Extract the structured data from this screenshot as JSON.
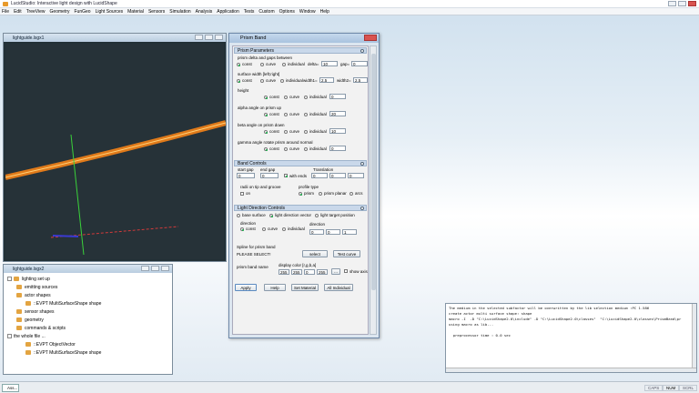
{
  "app": {
    "title": "LucidStudio: Interactive light design with LucidShape"
  },
  "menu": [
    "File",
    "Edit",
    "TreeView",
    "Geometry",
    "FunGeo",
    "Light Sources",
    "Material",
    "Sensors",
    "Simulation",
    "Analysis",
    "Application",
    "Tests",
    "Custom",
    "Options",
    "Window",
    "Help"
  ],
  "viewer": {
    "title": "lightguide.lsgx1"
  },
  "tree": {
    "title": "lightguide.lsgx2",
    "items": [
      "lighting set up",
      "emitting sources",
      "actor shapes",
      "::EVPT MultiSurfaceShape   shape",
      "sensor shapes",
      "geometry",
      "commands & scripts",
      "the whole file ...",
      "::EVPT ObjectVector",
      "::EVPT MultiSurfaceShape   shape"
    ]
  },
  "dialog": {
    "title": "Prism Band",
    "s1": "Prism Parameters",
    "gap_label": "prism delta and gaps between",
    "r_const": "const",
    "r_curve": "curve",
    "r_individual": "individual",
    "delta_label": "delta=",
    "delta_val": "10",
    "gap_label2": "gap=",
    "gap_val": "0",
    "width_label": "surface width [left;right]",
    "width1_label": "width1=",
    "width1_val": "2.5",
    "width2_label": "width2=",
    "width2_val": "2.5",
    "height_label": "height",
    "height_val": "0",
    "alpha_label": "alpha angle on prism up",
    "alpha_val": "20",
    "beta_label": "beta angle on prism down",
    "beta_val": "10",
    "gamma_label": "gamma angle rotate prism around normal",
    "gamma_val": "0",
    "s2": "Band Controls",
    "start_gap": "start gap",
    "end_gap": "end gap",
    "with_ends": "with ends",
    "translation": "Translation",
    "start_val": "0",
    "end_val": "0",
    "tx": "0",
    "ty": "0",
    "tz": "0",
    "radii_label": "radii on tip and groove",
    "on_label": "on",
    "profile_label": "profile type",
    "p_prism": "prism",
    "p_planar": "prism planar",
    "p_arcs": "arcs",
    "s3": "Light Direction Controls",
    "ld_base": "base surface",
    "ld_vector": "light direction vector",
    "ld_target": "light target position",
    "dir_label": "direction",
    "direction_label": "direction",
    "dx": "0",
    "dy": "0",
    "dz": "1",
    "spline_label": "Spline for prism band",
    "select_msg": "PLEASE SELECT!",
    "select_btn": "select",
    "test_btn": "Test curve",
    "name_label": "prism band name",
    "color_label": "display color [r,g,b,a]",
    "c_r": "255",
    "c_g": "255",
    "c_b": "0",
    "c_a": "255",
    "dots": "...",
    "show_axis": "show axis",
    "apply": "Apply",
    "help": "Help",
    "set_material": "Set Material",
    "all_individual": "All Individual"
  },
  "console": {
    "lines": [
      "The medium in the selected subfactor will be overwritten by the lib selection medium :PC 1.586",
      "create actor multi surface shape: shape",
      "macro -I  -D \"C:\\LucidShape2.0\\include\" -D \"C:\\LucidShape2.0\\classes\"  \"C:\\LucidShape2.0\\classes\\PrismBand\\pr",
      "using macro as lib...",
      "",
      "preprocessor time : 0.0 sec"
    ]
  },
  "taskbar": {
    "item": "Ass...",
    "caps": "CAPS",
    "num": "NUM",
    "scrl": "SCRL"
  }
}
